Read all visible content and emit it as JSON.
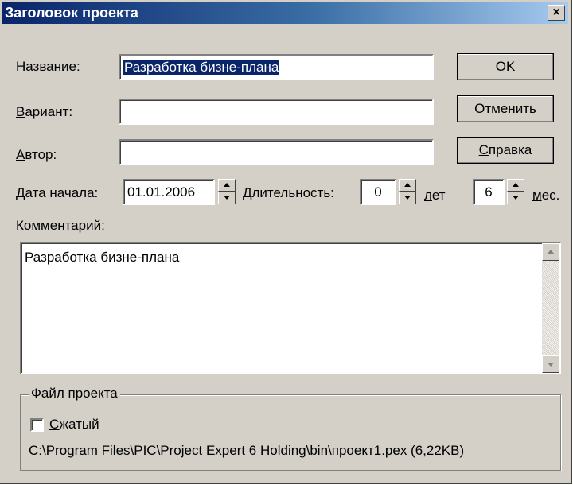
{
  "window": {
    "title": "Заголовок проекта",
    "close_glyph": "×"
  },
  "fields": {
    "name": {
      "label_u": "Н",
      "label_rest": "азвание:",
      "value": "Разработка бизне-плана"
    },
    "variant": {
      "label_u": "В",
      "label_rest": "ариант:",
      "value": ""
    },
    "author": {
      "label_u": "А",
      "label_rest": "втор:",
      "value": ""
    },
    "start_date": {
      "label_u": "Д",
      "label_rest": "ата начала:",
      "value": "01.01.2006"
    },
    "duration": {
      "label": "Длительность:",
      "years": "0",
      "years_unit_u": "л",
      "years_unit_rest": "ет",
      "months": "6",
      "months_unit_u": "м",
      "months_unit_rest": "ес."
    }
  },
  "buttons": {
    "ok": "OK",
    "cancel": "Отменить",
    "help_u": "С",
    "help_rest": "правка"
  },
  "comment": {
    "label_u": "К",
    "label_rest": "омментарий:",
    "text": "Разработка бизне-плана"
  },
  "project_file": {
    "group_label": "Файл проекта",
    "compressed_u": "С",
    "compressed_rest": "жатый",
    "compressed_checked": false,
    "path": "C:\\Program Files\\PIC\\Project Expert 6 Holding\\bin\\проект1.pex (6,22KB)"
  }
}
